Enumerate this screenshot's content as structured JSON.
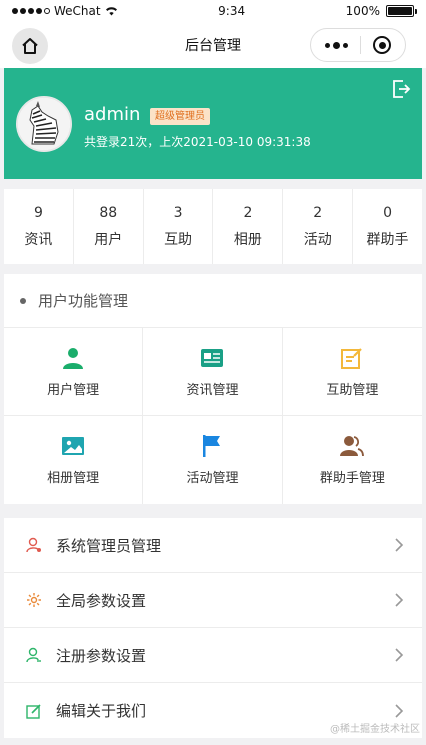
{
  "status_bar": {
    "carrier": "WeChat",
    "time": "9:34",
    "battery": "100%"
  },
  "nav": {
    "title": "后台管理"
  },
  "profile": {
    "username": "admin",
    "role": "超级管理员",
    "login_info": "共登录21次，上次2021-03-10 09:31:38"
  },
  "stats": [
    {
      "value": "9",
      "label": "资讯"
    },
    {
      "value": "88",
      "label": "用户"
    },
    {
      "value": "3",
      "label": "互助"
    },
    {
      "value": "2",
      "label": "相册"
    },
    {
      "value": "2",
      "label": "活动"
    },
    {
      "value": "0",
      "label": "群助手"
    }
  ],
  "function_section": {
    "title": "用户功能管理",
    "items": [
      {
        "label": "用户管理",
        "icon": "user-icon",
        "color": "#1aad6b"
      },
      {
        "label": "资讯管理",
        "icon": "news-card-icon",
        "color": "#1aa086"
      },
      {
        "label": "互助管理",
        "icon": "edit-note-icon",
        "color": "#f3b83a"
      },
      {
        "label": "相册管理",
        "icon": "photo-icon",
        "color": "#1fa5b0"
      },
      {
        "label": "活动管理",
        "icon": "flag-icon",
        "color": "#1a86e0"
      },
      {
        "label": "群助手管理",
        "icon": "group-icon",
        "color": "#8b5a3c"
      }
    ]
  },
  "settings_list": [
    {
      "label": "系统管理员管理",
      "icon": "admin-user-icon",
      "color": "#e05a4f"
    },
    {
      "label": "全局参数设置",
      "icon": "gear-icon",
      "color": "#e98a3a"
    },
    {
      "label": "注册参数设置",
      "icon": "register-user-icon",
      "color": "#2eb56a"
    },
    {
      "label": "编辑关于我们",
      "icon": "edit-icon",
      "color": "#2eb56a"
    }
  ],
  "watermark": "@稀土掘金技术社区"
}
